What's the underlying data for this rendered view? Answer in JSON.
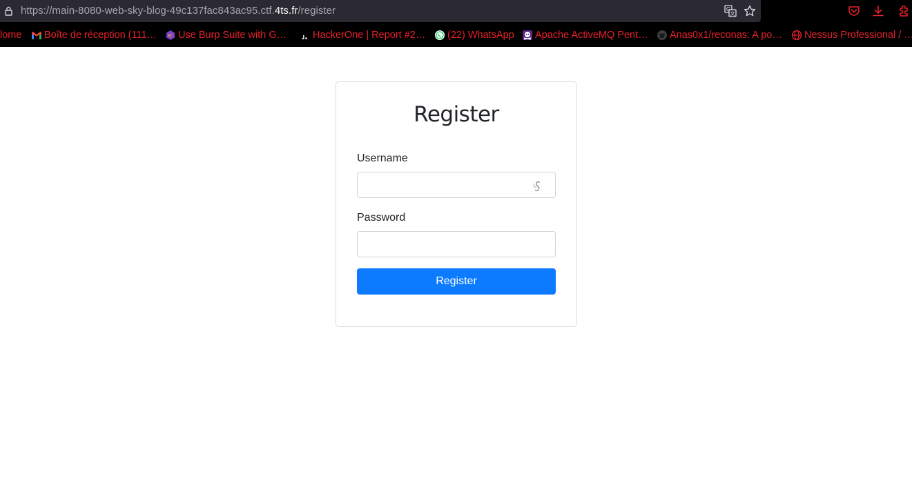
{
  "browser": {
    "url_dim_prefix": "https://main-8080-web-sky-blog-49c137fac843ac95.ctf.",
    "url_domain": "4ts.fr",
    "url_path": "/register"
  },
  "bookmarks": [
    {
      "label": "lome",
      "icon": "home-icon"
    },
    {
      "label": "Boîte de réception (111…",
      "icon": "gmail-icon"
    },
    {
      "label": "Use Burp Suite with G…",
      "icon": "burp-icon"
    },
    {
      "label": "HackerOne | Report #2…",
      "icon": "hackerone-icon"
    },
    {
      "label": "(22) WhatsApp",
      "icon": "whatsapp-icon"
    },
    {
      "label": "Apache ActiveMQ Pent…",
      "icon": "skull-icon"
    },
    {
      "label": "Anas0x1/reconas: A po…",
      "icon": "github-icon"
    },
    {
      "label": "Nessus Professional / …",
      "icon": "globe-icon"
    }
  ],
  "form": {
    "title": "Register",
    "username_label": "Username",
    "username_value": "",
    "password_label": "Password",
    "password_value": "",
    "submit_label": "Register"
  },
  "colors": {
    "bookmark_text": "#e8202a",
    "button_bg": "#0d7bff",
    "urlbar_bg": "#2b2a33"
  }
}
